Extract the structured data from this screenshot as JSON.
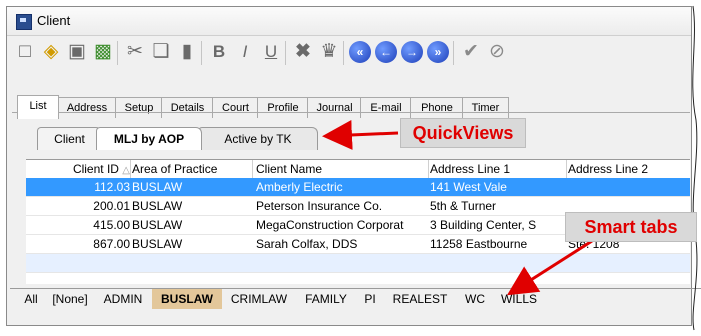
{
  "window": {
    "title": "Client"
  },
  "toolbar": {
    "buttons": [
      "new-doc-icon",
      "open-folder-icon",
      "save-icon",
      "save-close-icon",
      "cut-icon",
      "copy-icon",
      "paste-icon",
      "bold-icon",
      "italic-icon",
      "underline-icon",
      "delete-icon",
      "lookup-icon",
      "first-record-icon",
      "previous-record-icon",
      "next-record-icon",
      "last-record-icon",
      "check-icon",
      "cancel-icon"
    ]
  },
  "tabs": [
    "List",
    "Address",
    "Setup",
    "Details",
    "Court",
    "Profile",
    "Journal",
    "E-mail",
    "Phone",
    "Timer"
  ],
  "quickviews": {
    "tabs": [
      "Client",
      "MLJ by AOP",
      "Active by TK"
    ],
    "active": "MLJ by AOP"
  },
  "grid": {
    "columns": [
      "Client ID",
      "Area of Practice",
      "Client Name",
      "Address Line 1",
      "Address Line 2"
    ],
    "rows": [
      {
        "id": "112.03",
        "aop": "BUSLAW",
        "name": "Amberly Electric",
        "addr1": "141 West Vale",
        "addr2": ""
      },
      {
        "id": "200.01",
        "aop": "BUSLAW",
        "name": "Peterson Insurance Co.",
        "addr1": "5th & Turner",
        "addr2": ""
      },
      {
        "id": "415.00",
        "aop": "BUSLAW",
        "name": "MegaConstruction Corporat",
        "addr1": "3 Building Center, S",
        "addr2": ""
      },
      {
        "id": "867.00",
        "aop": "BUSLAW",
        "name": "Sarah Colfax, DDS",
        "addr1": "11258 Eastbourne",
        "addr2": "Ste. 1208"
      }
    ],
    "selected_row": 0
  },
  "smart_tabs": {
    "items": [
      "All",
      "[None]",
      "ADMIN",
      "BUSLAW",
      "CRIMLAW",
      "FAMILY",
      "PI",
      "REALEST",
      "WC",
      "WILLS"
    ],
    "active": "BUSLAW"
  },
  "callouts": {
    "quickviews": "QuickViews",
    "smart_tabs": "Smart tabs"
  },
  "colors": {
    "selection": "#3399ff",
    "active_smart_tab": "#e3c79a",
    "callout_text": "#e00000"
  }
}
